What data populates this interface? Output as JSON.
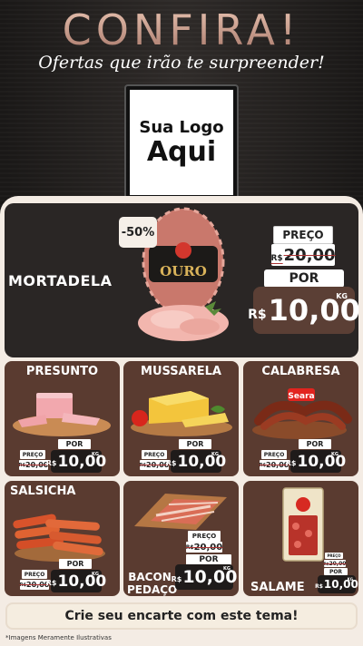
{
  "header": {
    "title": "CONFIRA!",
    "subtitle": "Ofertas que irão te surpreender!"
  },
  "logo": {
    "line1": "Sua Logo",
    "line2": "Aqui"
  },
  "featured": {
    "name": "MORTADELA",
    "discount_badge": "-50%",
    "product_brand": "OURO",
    "preco_label": "PREÇO",
    "old_currency": "R$",
    "old_price": "20,00",
    "por_label": "POR",
    "currency": "R$",
    "new_price": "10,00",
    "unit": "KG"
  },
  "products": [
    {
      "name": "PRESUNTO",
      "preco_label": "PREÇO",
      "old_currency": "R$",
      "old_price": "20,00",
      "por_label": "POR",
      "currency": "R$",
      "new_price": "10,00",
      "unit": "KG"
    },
    {
      "name": "MUSSARELA",
      "preco_label": "PREÇO",
      "old_currency": "R$",
      "old_price": "20,00",
      "por_label": "POR",
      "currency": "R$",
      "new_price": "10,00",
      "unit": "KG"
    },
    {
      "name": "CALABRESA",
      "brand": "Seara",
      "preco_label": "PREÇO",
      "old_currency": "R$",
      "old_price": "20,00",
      "por_label": "POR",
      "currency": "R$",
      "new_price": "10,00",
      "unit": "KG"
    },
    {
      "name": "SALSICHA",
      "preco_label": "PREÇO",
      "old_currency": "R$",
      "old_price": "20,00",
      "por_label": "POR",
      "currency": "R$",
      "new_price": "10,00",
      "unit": "KG"
    },
    {
      "name_line1": "BACON",
      "name_line2": "PEDAÇO",
      "preco_label": "PREÇO",
      "old_currency": "R$",
      "old_price": "20,00",
      "por_label": "POR",
      "currency": "R$",
      "new_price": "10,00",
      "unit": "KG"
    },
    {
      "name": "SALAME",
      "preco_label": "PREÇO",
      "old_currency": "R$",
      "old_price": "20,00",
      "por_label": "POR",
      "currency": "R$",
      "new_price": "10,00",
      "unit": "KG"
    }
  ],
  "cta": "Crie seu encarte com este tema!",
  "footnote": "*Imagens Meramente Ilustrativas",
  "colors": {
    "background": "#1e1c1b",
    "panel": "#f4ece4",
    "card": "#5a3b30",
    "featured_card": "#2a2625",
    "price_box": "#5b3f35",
    "accent_title": "#c99a86"
  }
}
